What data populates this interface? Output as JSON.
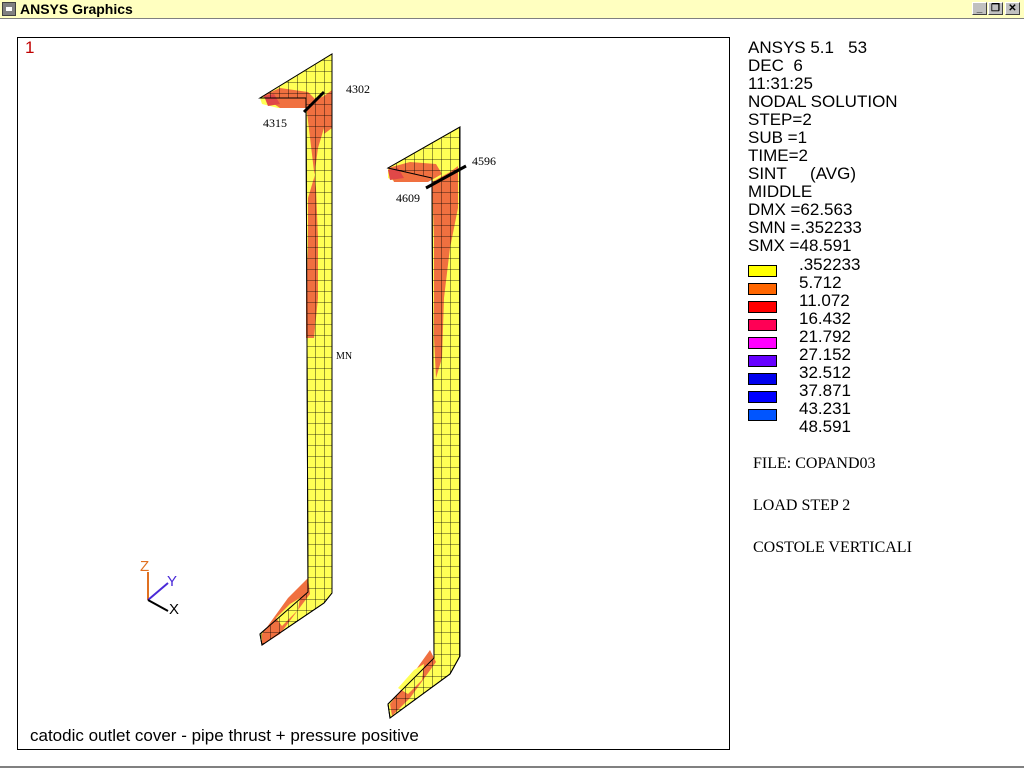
{
  "window": {
    "title": "ANSYS Graphics",
    "minimize_label": "_",
    "restore_label": "❐",
    "close_label": "✕"
  },
  "viewport": {
    "window_number": "1",
    "caption": "catodic outlet cover - pipe thrust + pressure positive",
    "node_labels": [
      "4302",
      "4315",
      "4596",
      "4609",
      "MN"
    ],
    "triad": {
      "z": "Z",
      "y": "Y",
      "x": "X"
    }
  },
  "info_panel": {
    "lines": [
      "ANSYS 5.1   53",
      "DEC  6",
      "11:31:25",
      "NODAL SOLUTION",
      "STEP=2",
      "SUB =1",
      "TIME=2",
      "SINT     (AVG)",
      "MIDDLE",
      "DMX =62.563",
      "SMN =.352233",
      "SMX =48.591"
    ]
  },
  "legend": {
    "entries": [
      {
        "value": ".352233",
        "color": "#ffff00"
      },
      {
        "value": "5.712",
        "color": "#ff6600"
      },
      {
        "value": "11.072",
        "color": "#ff0000"
      },
      {
        "value": "16.432",
        "color": "#ff0055"
      },
      {
        "value": "21.792",
        "color": "#ff00ff"
      },
      {
        "value": "27.152",
        "color": "#6600ff"
      },
      {
        "value": "32.512",
        "color": "#0000ee"
      },
      {
        "value": "37.871",
        "color": "#0000ff"
      },
      {
        "value": "43.231",
        "color": "#0055ff"
      },
      {
        "value": "48.591",
        "color": "#00ffff"
      }
    ]
  },
  "notes": {
    "file": "FILE: COPAND03",
    "load_step": "LOAD STEP 2",
    "title": "COSTOLE VERTICALI"
  },
  "colors": {
    "contour_low": "#ffff55",
    "contour_mid": "#f07040",
    "contour_high": "#e04848",
    "mesh_line": "#000000"
  }
}
